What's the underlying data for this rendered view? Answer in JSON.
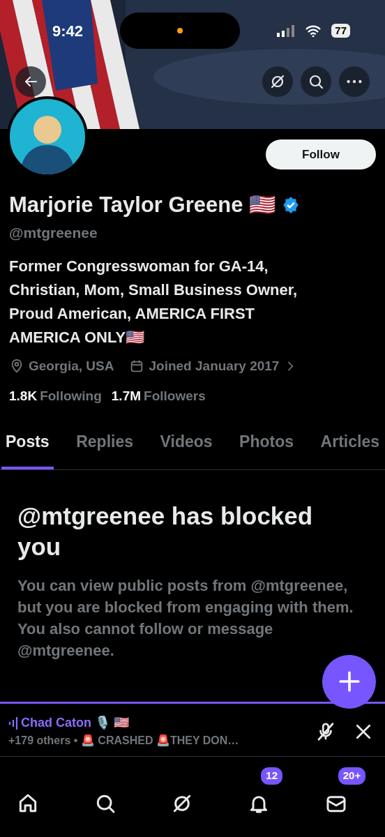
{
  "status_bar": {
    "time": "9:42",
    "battery": "77"
  },
  "header": {
    "actions": [
      {
        "kind": "grok"
      },
      {
        "kind": "search"
      },
      {
        "kind": "more"
      }
    ]
  },
  "profile": {
    "name": "Marjorie Taylor Greene 🇺🇸",
    "verified": true,
    "handle": "@mtgreenee",
    "follow_button": "Follow",
    "bio": "Former Congresswoman for GA-14, Christian, Mom, Small Business Owner, Proud American, AMERICA FIRST AMERICA ONLY🇺🇸",
    "location": "Georgia, USA",
    "joined": "Joined January 2017",
    "stats": [
      {
        "count": "1.8K",
        "label": "Following"
      },
      {
        "count": "1.7M",
        "label": "Followers"
      }
    ]
  },
  "tabs": [
    {
      "label": "Posts",
      "selected": true
    },
    {
      "label": "Replies",
      "selected": false
    },
    {
      "label": "Videos",
      "selected": false
    },
    {
      "label": "Photos",
      "selected": false
    },
    {
      "label": "Articles",
      "selected": false
    }
  ],
  "blocked": {
    "title": "@mtgreenee has blocked you",
    "message": "You can view public posts from @mtgreenee, but you are blocked from engaging with them. You also cannot follow or message @mtgreenee."
  },
  "space": {
    "host": "Chad Caton 🎙️ 🇺🇸",
    "subtitle": "+179 others • 🚨 CRASHED 🚨THEY DON…"
  },
  "nav": [
    {
      "kind": "home"
    },
    {
      "kind": "search"
    },
    {
      "kind": "grok"
    },
    {
      "kind": "bell",
      "badge": "12"
    },
    {
      "kind": "mail",
      "badge": "20+"
    }
  ]
}
